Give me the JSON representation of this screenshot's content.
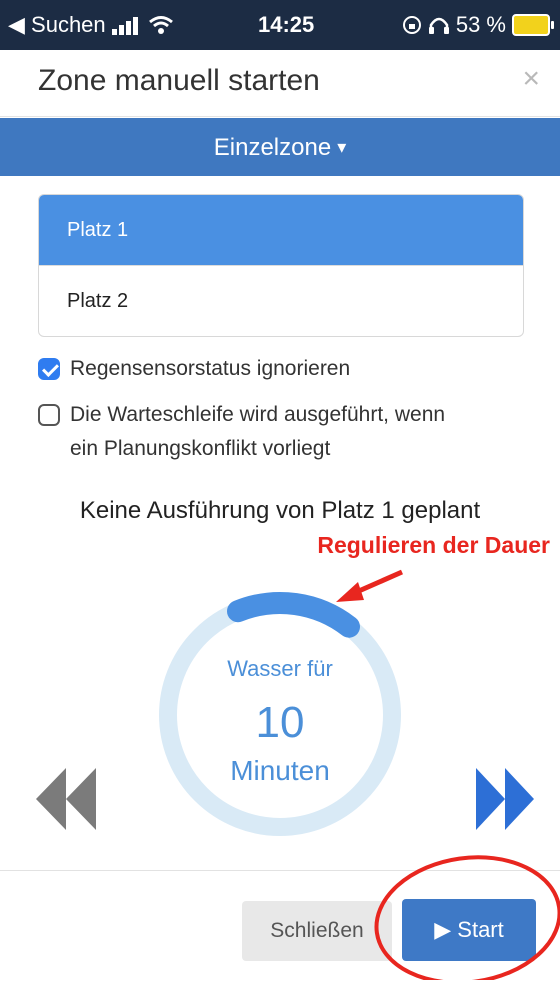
{
  "status_bar": {
    "back_label": "◀ Suchen",
    "time": "14:25",
    "battery": "53 %"
  },
  "modal": {
    "title": "Zone manuell starten",
    "close_glyph": "×"
  },
  "zone_selector": {
    "label": "Einzelzone",
    "caret": "▾"
  },
  "zones": [
    {
      "label": "Platz 1",
      "selected": true
    },
    {
      "label": "Platz 2",
      "selected": false
    }
  ],
  "options": {
    "ignore_rain_sensor": {
      "label": "Regensensorstatus ignorieren",
      "checked": true
    },
    "queue": {
      "label_line1": "Die Warteschleife wird ausgeführt, wenn",
      "label_line2": "ein Planungskonflikt vorliegt",
      "checked": false
    }
  },
  "schedule_text": "Keine Ausführung von Platz 1 geplant",
  "annotation": {
    "text": "Regulieren der Dauer",
    "color": "#e8261f"
  },
  "duration_dial": {
    "prefix": "Wasser für",
    "value": "10",
    "unit": "Minuten",
    "track_color": "#d9eaf6",
    "fill_color": "#4a90e2"
  },
  "footer": {
    "close_label": "Schließen",
    "start_label": "▶ Start"
  },
  "icons": {
    "prev": "double-chevron-left-icon",
    "next": "double-chevron-right-icon"
  },
  "colors": {
    "status_bar": "#1c2c44",
    "primary": "#3f78c0",
    "selected_zone": "#4a90e2",
    "checkbox": "#2f7cf0"
  }
}
